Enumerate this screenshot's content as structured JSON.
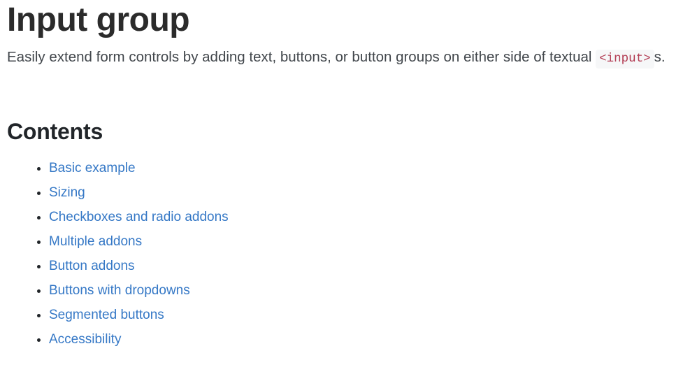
{
  "page": {
    "title": "Input group",
    "lead": {
      "text_before": "Easily extend form controls by adding text, buttons, or button groups on either side of textual ",
      "code": "<input>",
      "text_after": "s."
    },
    "contents_heading": "Contents",
    "contents": [
      {
        "label": "Basic example"
      },
      {
        "label": "Sizing"
      },
      {
        "label": "Checkboxes and radio addons"
      },
      {
        "label": "Multiple addons"
      },
      {
        "label": "Button addons"
      },
      {
        "label": "Buttons with dropdowns"
      },
      {
        "label": "Segmented buttons"
      },
      {
        "label": "Accessibility"
      }
    ]
  },
  "colors": {
    "background": "#ffffff",
    "heading": "#2b2b2b",
    "lead_text": "#41464b",
    "code_text": "#b23c53",
    "code_background": "#f6f7f8",
    "link": "#3578c6",
    "bullet": "#212529"
  }
}
